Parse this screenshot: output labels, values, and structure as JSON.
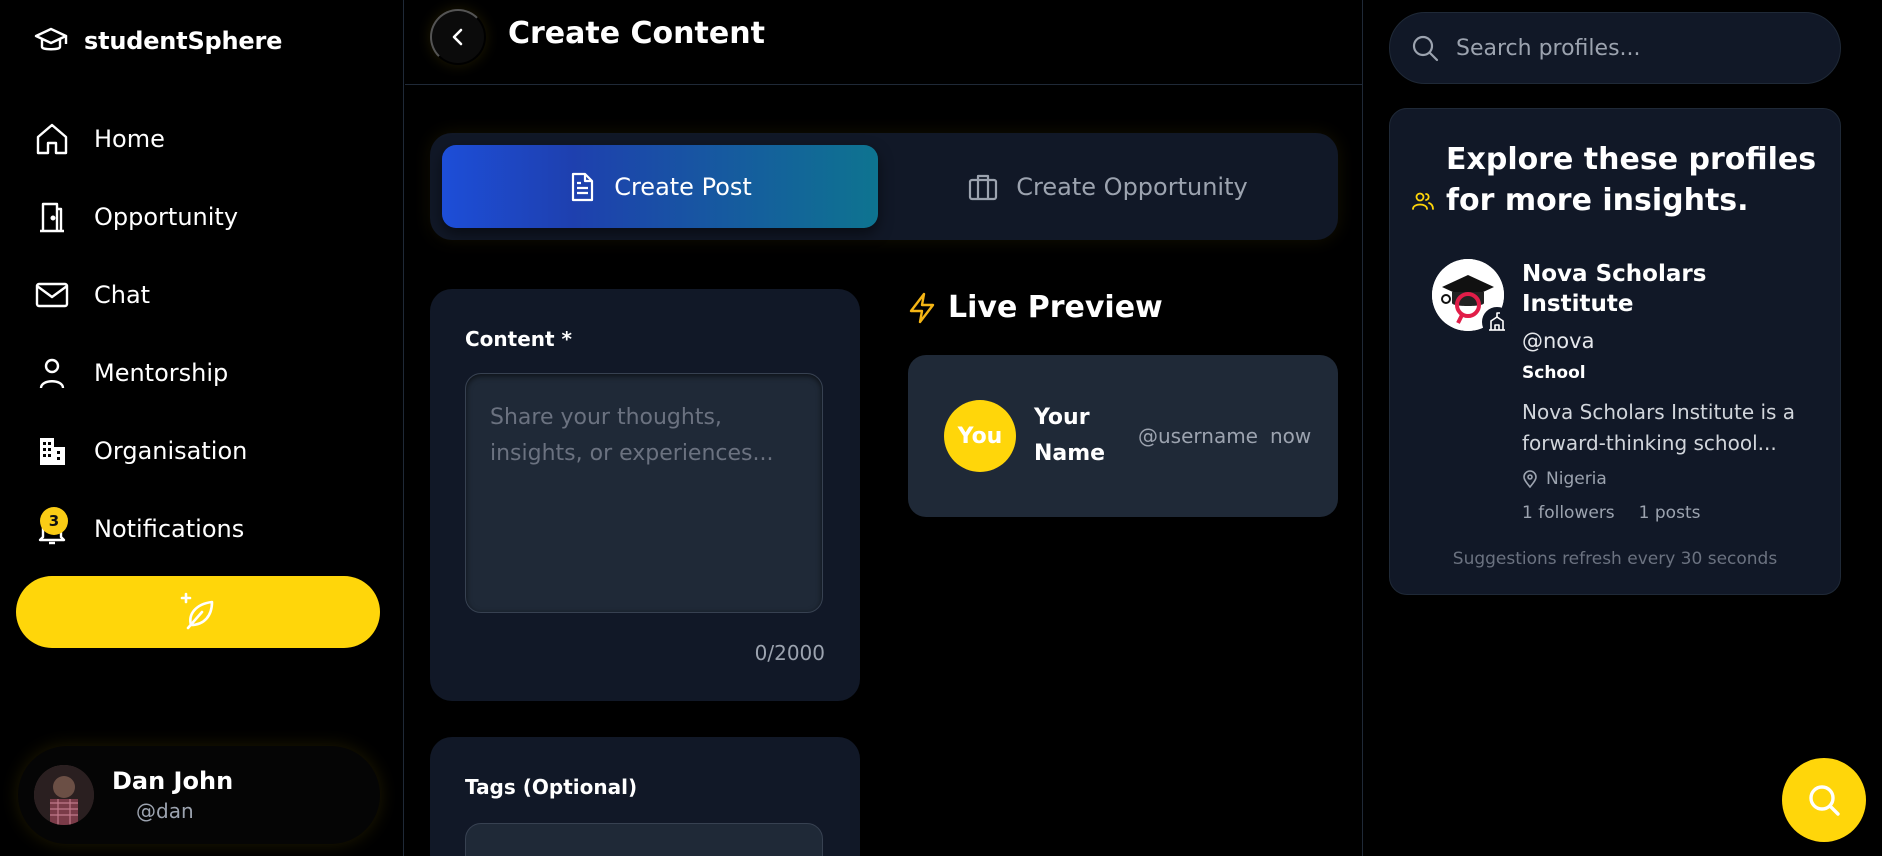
{
  "brand": {
    "name": "studentSphere",
    "icon": "graduation-cap-icon"
  },
  "sidebar": {
    "items": [
      {
        "label": "Home",
        "icon": "home-icon"
      },
      {
        "label": "Opportunity",
        "icon": "door-icon"
      },
      {
        "label": "Chat",
        "icon": "mail-icon"
      },
      {
        "label": "Mentorship",
        "icon": "user-icon"
      },
      {
        "label": "Organisation",
        "icon": "building-icon"
      },
      {
        "label": "Notifications",
        "icon": "bell-icon",
        "badge": "3"
      }
    ],
    "compose_icon": "feather-plus-icon",
    "user": {
      "name": "Dan John",
      "handle": "@dan"
    }
  },
  "header": {
    "title": "Create Content"
  },
  "tabs": [
    {
      "label": "Create Post",
      "icon": "document-icon",
      "active": true
    },
    {
      "label": "Create Opportunity",
      "icon": "briefcase-icon",
      "active": false
    }
  ],
  "content_form": {
    "label": "Content *",
    "placeholder": "Share your thoughts, insights, or experiences...",
    "value": "",
    "counter": "0/2000"
  },
  "tags_form": {
    "label": "Tags (Optional)"
  },
  "preview": {
    "title": "Live Preview",
    "avatar_text": "You",
    "name": "Your Name",
    "handle": "@username",
    "time": "now"
  },
  "right": {
    "search_placeholder": "Search profiles...",
    "explore_title": "Explore these profiles for more insights.",
    "profile": {
      "name": "Nova Scholars Institute",
      "handle": "@nova",
      "type": "School",
      "bio": "Nova Scholars Institute is a forward-thinking school...",
      "location": "Nigeria",
      "followers": "1 followers",
      "posts": "1 posts"
    },
    "refresh_note": "Suggestions refresh every 30 seconds"
  },
  "colors": {
    "accent": "#ffd60a",
    "panel": "#111827",
    "tab_gradient_start": "#1d4ed8",
    "tab_gradient_end": "#0e7490"
  }
}
